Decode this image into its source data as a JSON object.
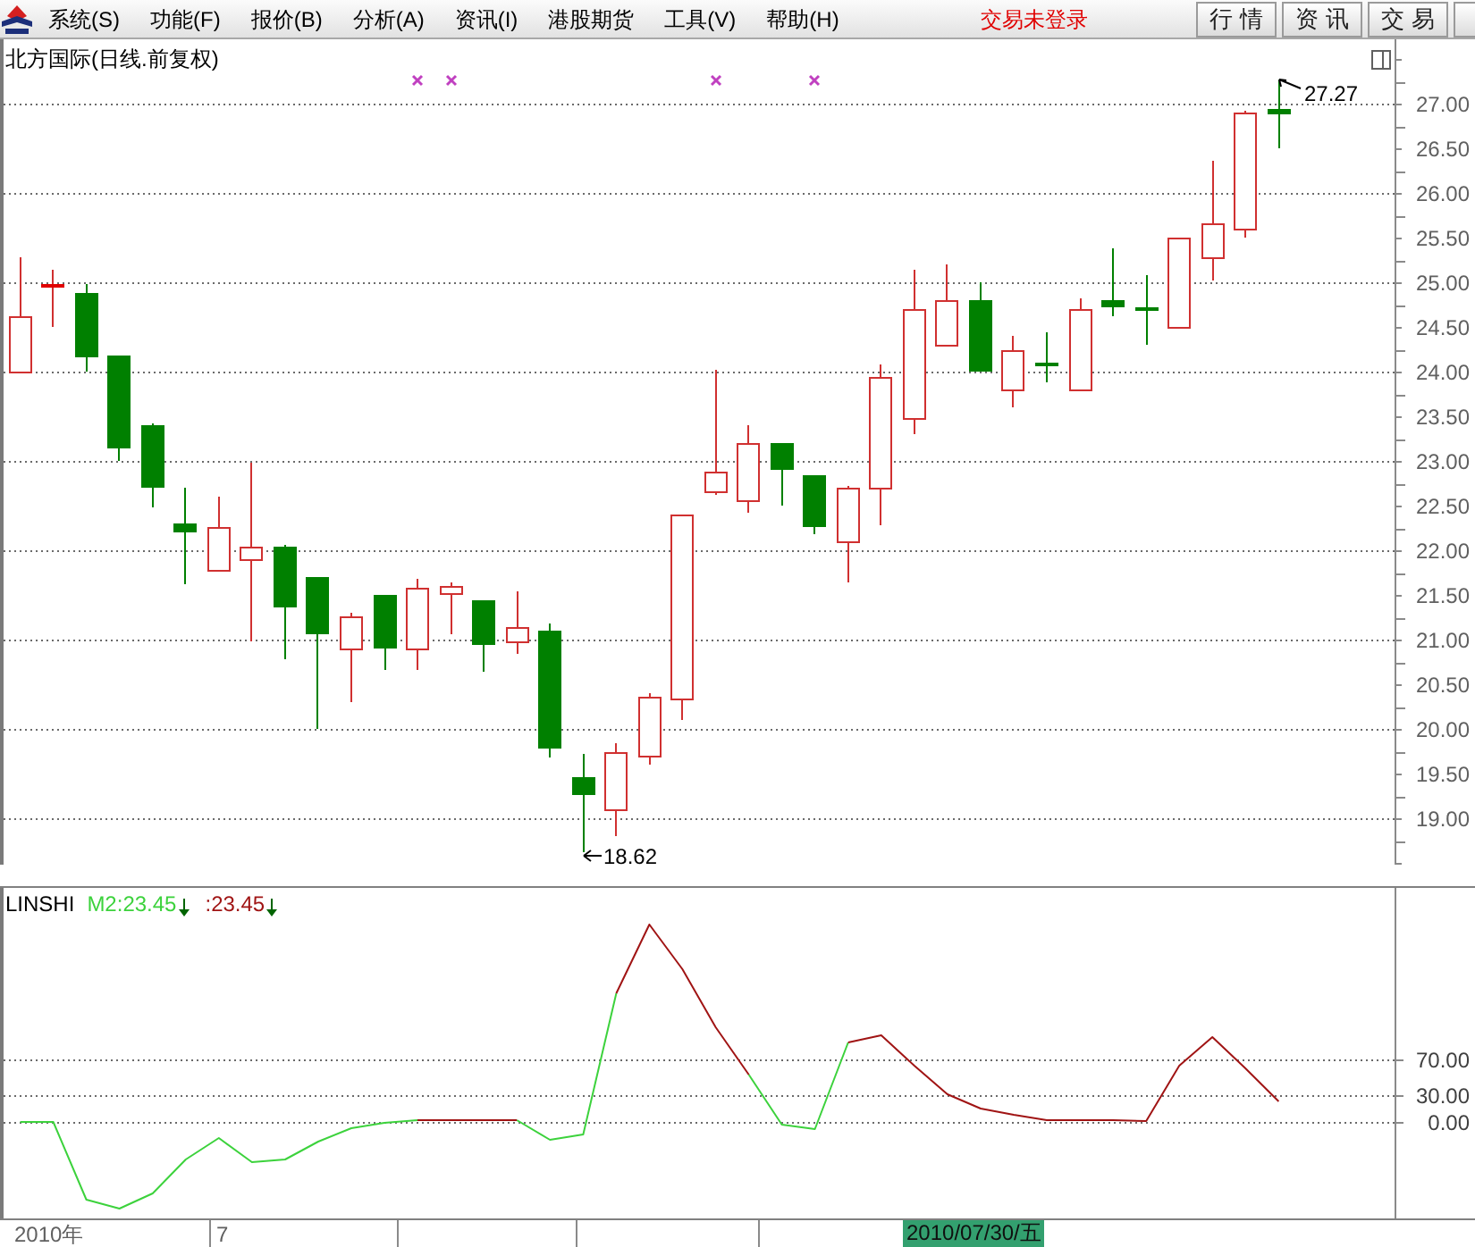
{
  "menu_bar": {
    "items": [
      "系统(S)",
      "功能(F)",
      "报价(B)",
      "分析(A)",
      "资讯(I)",
      "港股期货",
      "工具(V)",
      "帮助(H)"
    ],
    "trade_status": "交易未登录",
    "buttons": [
      "行 情",
      "资 讯",
      "交 易"
    ]
  },
  "price_panel": {
    "title": "北方国际(日线.前复权)",
    "axis_labels": [
      "27.00",
      "26.50",
      "26.00",
      "25.50",
      "25.00",
      "24.50",
      "24.00",
      "23.50",
      "23.00",
      "22.50",
      "22.00",
      "21.50",
      "21.00",
      "20.50",
      "20.00",
      "19.50",
      "19.00"
    ],
    "high_label": "27.27",
    "low_label": "18.62"
  },
  "indicator_panel": {
    "name": "LINSHI",
    "legend": [
      ":23.45",
      ":23.45"
    ],
    "chart_data": {
      "type": "line",
      "series": [
        {
          "name": "M2",
          "color": "#3cd23c",
          "values": [
            0,
            0,
            -87,
            -97,
            -80,
            -42,
            -18,
            -45,
            -42,
            -22,
            -7,
            -1,
            2,
            null,
            null,
            2,
            -20,
            -14,
            144,
            null,
            null,
            null,
            53,
            -3,
            -8,
            89,
            null,
            null,
            null,
            null,
            null,
            null,
            null,
            null,
            null,
            null,
            null,
            null,
            null,
            null,
            null,
            null
          ]
        },
        {
          "color": "#a01414",
          "values": [
            null,
            null,
            null,
            null,
            null,
            null,
            null,
            null,
            null,
            null,
            null,
            null,
            2,
            2,
            2,
            2,
            null,
            null,
            144,
            221,
            171,
            106,
            53,
            null,
            null,
            89,
            97,
            63,
            31,
            15,
            8,
            2,
            2,
            2,
            1,
            63,
            95,
            60,
            23,
            null,
            null,
            null
          ]
        }
      ],
      "ylim": [
        -108,
        262
      ],
      "yticks": [
        {
          "value": 0,
          "label": "0.00"
        },
        {
          "value": 30,
          "label": "30.00"
        },
        {
          "value": 70,
          "label": "70.00"
        }
      ],
      "grid": true
    }
  },
  "time_axis": {
    "labels": [
      "2010年",
      "7"
    ],
    "cursor_date": "2010/07/30/五"
  }
}
